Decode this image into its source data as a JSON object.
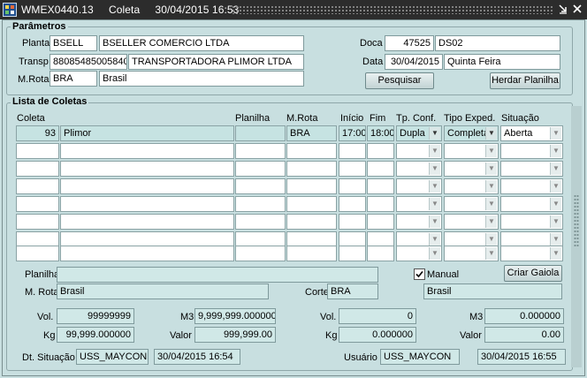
{
  "window": {
    "title": "WMEX0440.13     Coleta     30/04/2015 16:53",
    "minimize_icon": "minimize-icon",
    "close_icon": "close-icon"
  },
  "parametros": {
    "title": "Parâmetros",
    "planta_label": "Planta",
    "planta_code": "BSELL",
    "planta_name": "BSELLER COMERCIO LTDA",
    "transp_label": "Transp",
    "transp_code": "88085485005840",
    "transp_name": "TRANSPORTADORA PLIMOR LTDA",
    "mrota_label": "M.Rota",
    "mrota_code": "BRA",
    "mrota_name": "Brasil",
    "doca_label": "Doca",
    "doca_code": "47525",
    "doca_name": "DS02",
    "data_label": "Data",
    "data_value": "30/04/2015",
    "data_weekday": "Quinta Feira",
    "pesquisar_label": "Pesquisar",
    "herdar_label": "Herdar Planilha"
  },
  "lista": {
    "title": "Lista de Coletas",
    "headers": {
      "coleta": "Coleta",
      "planilha": "Planilha",
      "mrota": "M.Rota",
      "inicio": "Início",
      "fim": "Fim",
      "tpconf": "Tp. Conf.",
      "tipoexped": "Tipo Exped.",
      "situacao": "Situação"
    },
    "row1": {
      "coleta": "93",
      "nome": "Plimor",
      "planilha": "",
      "mrota": "BRA",
      "inicio": "17:00",
      "fim": "18:00",
      "tpconf": "Dupla",
      "tipoexped": "Completa",
      "situacao": "Aberta"
    }
  },
  "detalhe": {
    "planilha_label": "Planilha",
    "planilha_value": "",
    "manual_label": "Manual",
    "manual_checked": true,
    "criar_gaiola_label": "Criar Gaiola",
    "mrota_label": "M. Rota",
    "mrota_value": "Brasil",
    "corte_label": "Corte",
    "corte_code": "BRA",
    "corte_name": "Brasil"
  },
  "totais": {
    "vol_label": "Vol.",
    "vol_value": "99999999",
    "kg_label": "Kg",
    "kg_value": "99,999.000000",
    "m3_label": "M3",
    "m3_value": "9,999,999.000000",
    "valor_label": "Valor",
    "valor_value": "999,999.00",
    "vol2_label": "Vol.",
    "vol2_value": "0",
    "kg2_label": "Kg",
    "kg2_value": "0.000000",
    "m3_2_label": "M3",
    "m3_2_value": "0.000000",
    "valor2_label": "Valor",
    "valor2_value": "0.00"
  },
  "rodape": {
    "dt_situacao_label": "Dt. Situação",
    "dt_situacao_user": "USS_MAYCON",
    "dt_situacao_value": "30/04/2015 16:54",
    "usuario_label": "Usuário",
    "usuario_user": "USS_MAYCON",
    "usuario_value": "30/04/2015 16:55"
  }
}
